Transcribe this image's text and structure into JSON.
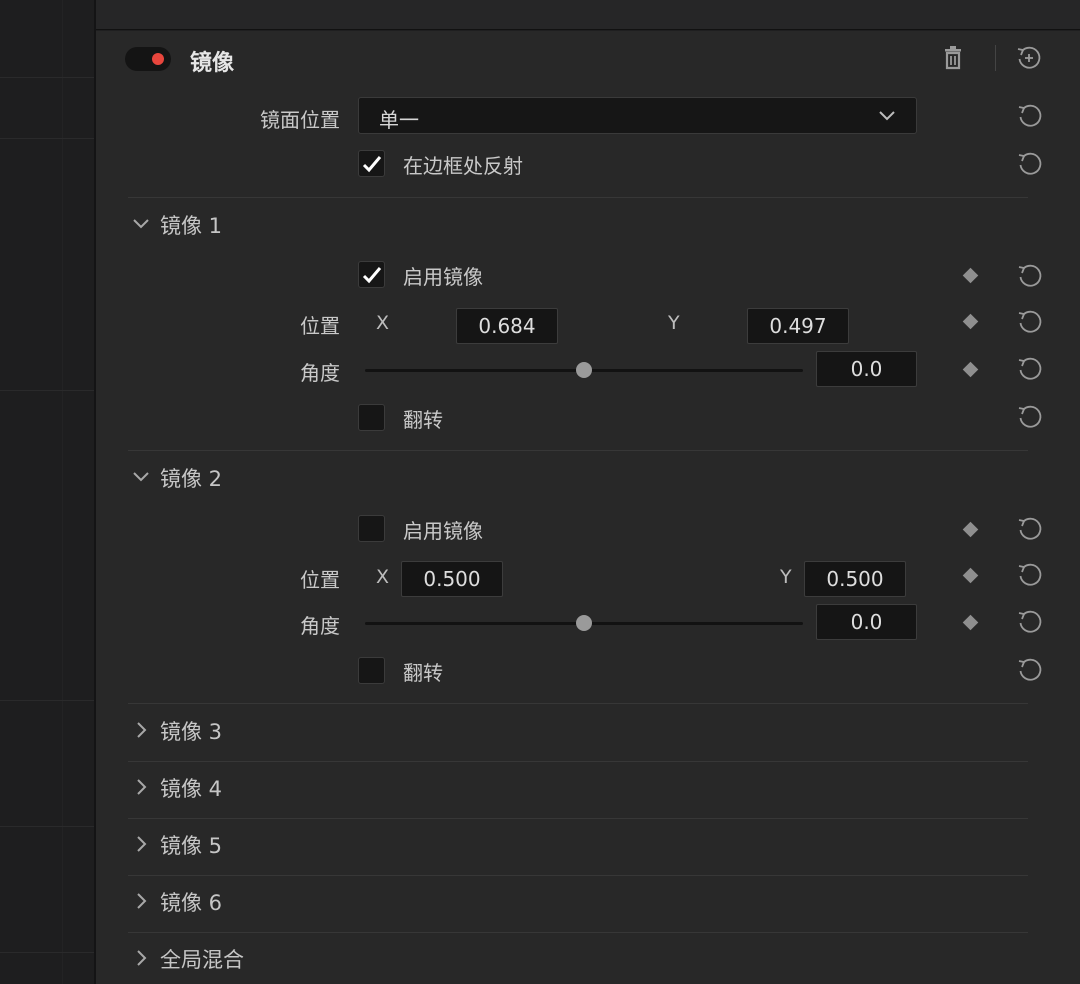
{
  "header": {
    "title": "镜像"
  },
  "mirror_position": {
    "label": "镜面位置",
    "value": "单一"
  },
  "reflect_at_border": {
    "label": "在边框处反射",
    "checked": true
  },
  "mirror1": {
    "title": "镜像 1",
    "enable_label": "启用镜像",
    "enabled": true,
    "position_label": "位置",
    "x_label": "X",
    "x": "0.684",
    "y_label": "Y",
    "y": "0.497",
    "angle_label": "角度",
    "angle": "0.0",
    "angle_slider": 0.5,
    "flip_label": "翻转",
    "flip": false
  },
  "mirror2": {
    "title": "镜像 2",
    "enable_label": "启用镜像",
    "enabled": false,
    "position_label": "位置",
    "x_label": "X",
    "x": "0.500",
    "y_label": "Y",
    "y": "0.500",
    "angle_label": "角度",
    "angle": "0.0",
    "angle_slider": 0.5,
    "flip_label": "翻转",
    "flip": false
  },
  "collapsed_sections": [
    "镜像 3",
    "镜像 4",
    "镜像 5",
    "镜像 6",
    "全局混合"
  ],
  "icons": [
    "toggle",
    "trash-icon",
    "reset-icon",
    "keyframe-diamond-icon",
    "chevron-down-icon",
    "chevron-right-icon",
    "checkmark-icon"
  ],
  "colors": {
    "toggle_on": "#e8463d",
    "background": "#282828",
    "field": "#151515"
  }
}
